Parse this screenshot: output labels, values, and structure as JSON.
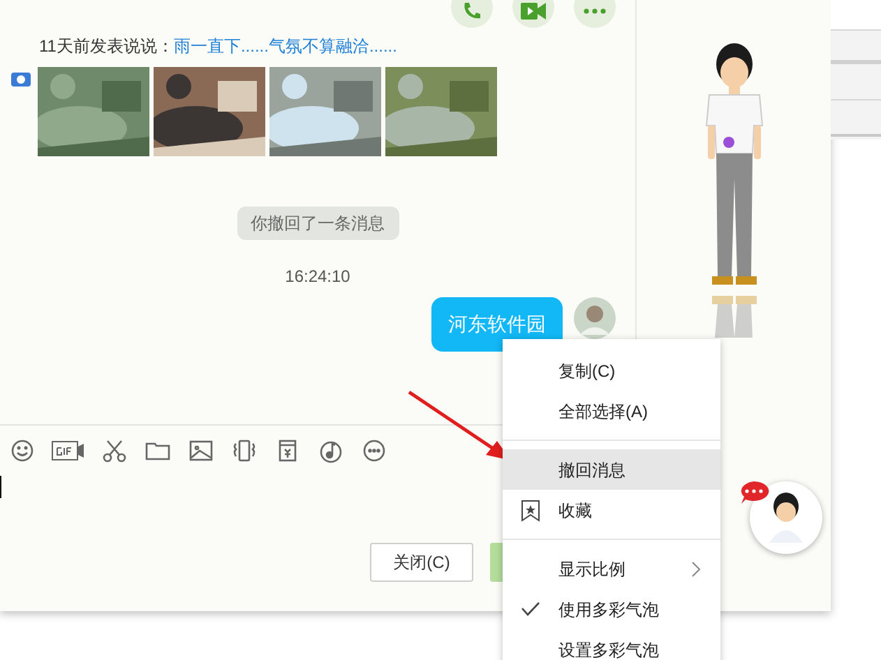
{
  "feed": {
    "prefix": "11天前发表说说：",
    "text": "雨一直下......气氛不算融洽......",
    "photos": [
      {
        "kind": "forest"
      },
      {
        "kind": "food"
      },
      {
        "kind": "ticket"
      },
      {
        "kind": "pond"
      }
    ]
  },
  "system_notice": "你撤回了一条消息",
  "time": "16:24:10",
  "messages": [
    {
      "text": "河东软件园",
      "outgoing": true
    }
  ],
  "buttons": [
    {
      "label": "关闭(C)",
      "kind": "close"
    },
    {
      "kind": "send"
    }
  ],
  "context_menu": [
    {
      "kind": "item",
      "label": "复制(C)",
      "selected": false
    },
    {
      "kind": "item",
      "label": "全部选择(A)",
      "selected": false
    },
    {
      "kind": "separator"
    },
    {
      "kind": "item",
      "label": "撤回消息",
      "selected": true
    },
    {
      "kind": "bookmark",
      "label": "收藏",
      "selected": false
    },
    {
      "kind": "separator"
    },
    {
      "kind": "submenu",
      "label": "显示比例",
      "selected": false
    },
    {
      "kind": "check",
      "label": "使用多彩气泡",
      "selected": false,
      "checked": true
    },
    {
      "kind": "check",
      "label": "设置多彩气泡",
      "selected": false,
      "checked": false
    }
  ]
}
